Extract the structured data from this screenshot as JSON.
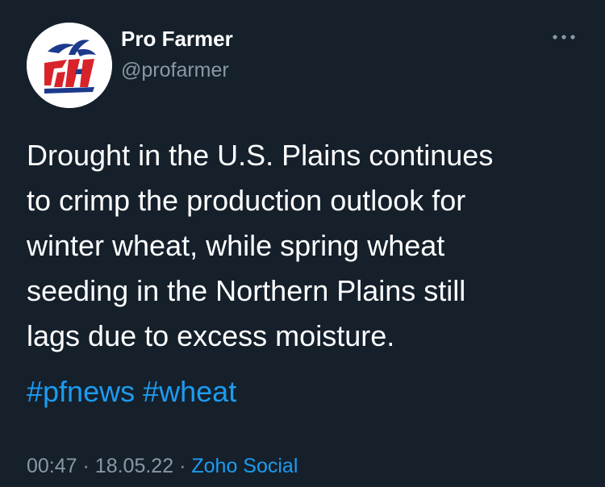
{
  "author": {
    "display_name": "Pro Farmer",
    "handle": "@profarmer",
    "avatar_logo_text": "PF"
  },
  "tweet": {
    "text": "Drought in the U.S. Plains continues\nto crimp the production outlook for\nwinter wheat, while spring wheat\nseeding in the Northern Plains still\nlags due to excess moisture.",
    "hashtags": [
      "#pfnews",
      "#wheat"
    ],
    "time": "00:47",
    "separator": "·",
    "date": "18.05.22",
    "source": "Zoho Social"
  },
  "icons": {
    "more": "more-horizontal-icon"
  },
  "colors": {
    "background": "#15202b",
    "primary_text": "#ffffff",
    "secondary_text": "#8899a6",
    "link": "#1d9bf0",
    "logo_red": "#d8232a",
    "logo_blue": "#1b3a8c"
  }
}
